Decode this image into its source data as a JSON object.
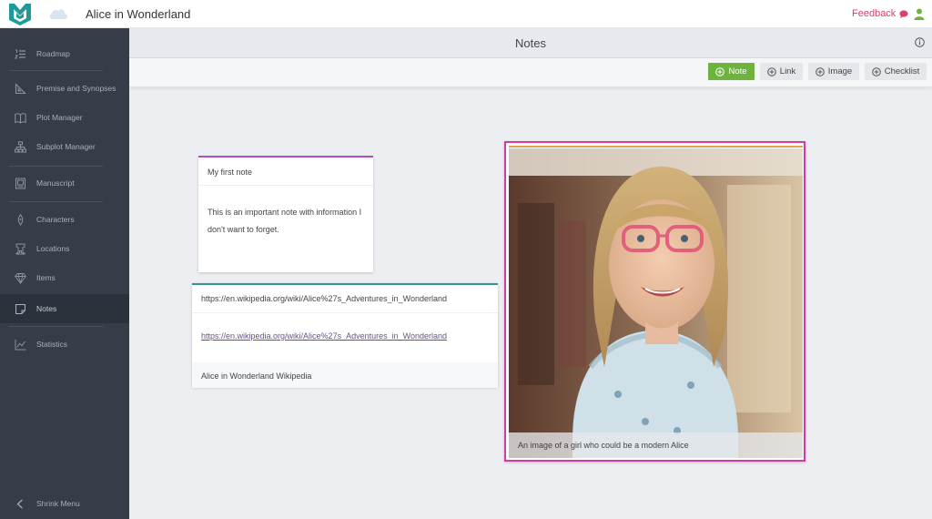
{
  "app": {
    "title": "Alice in Wonderland",
    "feedback_label": "Feedback",
    "brand_color": "#1f9a9a",
    "feedback_color": "#d9416b"
  },
  "sidebar": {
    "items": [
      {
        "label": "Roadmap",
        "icon": "list-numbered-icon"
      },
      {
        "label": "Premise and Synopses",
        "icon": "triangle-ruler-icon"
      },
      {
        "label": "Plot Manager",
        "icon": "open-book-icon"
      },
      {
        "label": "Subplot Manager",
        "icon": "hierarchy-icon"
      },
      {
        "label": "Manuscript",
        "icon": "manuscript-icon"
      },
      {
        "label": "Characters",
        "icon": "pen-nib-icon"
      },
      {
        "label": "Locations",
        "icon": "tower-icon"
      },
      {
        "label": "Items",
        "icon": "diamond-icon"
      },
      {
        "label": "Notes",
        "icon": "note-icon",
        "active": true
      },
      {
        "label": "Statistics",
        "icon": "line-chart-icon"
      }
    ],
    "shrink_label": "Shrink Menu"
  },
  "notes_page": {
    "title": "Notes",
    "toolbar": {
      "note_label": "Note",
      "link_label": "Link",
      "image_label": "Image",
      "checklist_label": "Checklist"
    }
  },
  "cards": {
    "note": {
      "title": "My first note",
      "body": "This is an important note with information I don't want to forget.",
      "accent": "#b24fbd"
    },
    "link": {
      "url_heading": "https://en.wikipedia.org/wiki/Alice%27s_Adventures_in_Wonderland",
      "url": "https://en.wikipedia.org/wiki/Alice%27s_Adventures_in_Wonderland",
      "description": "Alice in Wonderland Wikipedia",
      "accent": "#2e9a8e"
    },
    "image": {
      "caption": "An image of a girl who could be a modern Alice",
      "accent": "#d33aa6"
    }
  }
}
